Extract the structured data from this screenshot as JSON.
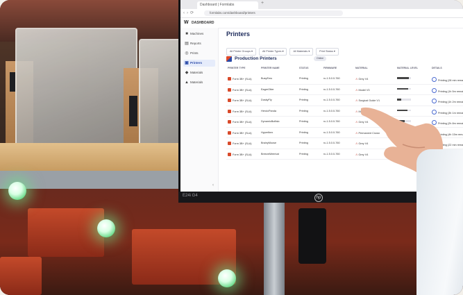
{
  "browser": {
    "tab_title": "Dashboard | Formlabs",
    "new_tab": "+",
    "url": "formlabs.com/dashboard/printers"
  },
  "app": {
    "brand": "DASHBOARD"
  },
  "sidebar": {
    "items": [
      {
        "label": "Machines",
        "icon": "machine-icon"
      },
      {
        "label": "Reports",
        "icon": "report-icon"
      },
      {
        "label": "Prints",
        "icon": "print-icon"
      },
      {
        "label": "Printers",
        "icon": "printer-icon"
      },
      {
        "label": "Materials",
        "icon": "material-icon"
      },
      {
        "label": "Materials",
        "icon": "flask-icon"
      }
    ],
    "active_index": 3
  },
  "main": {
    "title": "Printers",
    "filters": [
      "All Printer Groups",
      "All Printer Types",
      "All Materials",
      "Print Status"
    ],
    "section_title": "Production Printers",
    "section_badge": "Online"
  },
  "table": {
    "columns": [
      "PRINTER TYPE",
      "PRINTER NAME",
      "STATUS",
      "FIRMWARE",
      "MATERIAL",
      "MATERIAL LEVEL",
      "DETAILS"
    ],
    "rows": [
      {
        "type": "Form 3B+ (SLA)",
        "name": "BusyEmu",
        "status": "Printing",
        "firmware": "rc-1.5.0.0-760",
        "material": "Grey V4",
        "level": 0.85,
        "details": "Printing (28 min remain)"
      },
      {
        "type": "Form 3B+ (SLA)",
        "name": "EagerOtter",
        "status": "Printing",
        "firmware": "rc-1.5.0.0-760",
        "material": "Model V3",
        "level": 0.8,
        "details": "Printing (1h 5m remain)"
      },
      {
        "type": "Form 3B+ (SLA)",
        "name": "DuskyFly",
        "status": "Printing",
        "firmware": "rc-1.5.0.0-760",
        "material": "Surgical Guide V1",
        "level": 0.3,
        "details": "Printing (1h 2m remain)"
      },
      {
        "type": "Form 3B+ (SLA)",
        "name": "HeroicPanda",
        "status": "Printing",
        "firmware": "rc-1.5.0.0-760",
        "material": "Model V3",
        "level": 0.75,
        "details": "Printing (3h 1m remain)"
      },
      {
        "type": "Form 3B+ (SLA)",
        "name": "DynamicBuffalo",
        "status": "Printing",
        "firmware": "rc-1.5.0.0-760",
        "material": "Grey V4",
        "level": 0.55,
        "details": "Printing (2h 8m remain)"
      },
      {
        "type": "Form 3B+ (SLA)",
        "name": "HyperIbex",
        "status": "Printing",
        "firmware": "rc-1.5.0.0-760",
        "material": "Permanent Crown",
        "level": 0.4,
        "details": "Printing (4h 15m remain)"
      },
      {
        "type": "Form 3B+ (SLA)",
        "name": "BrainyMoose",
        "status": "Printing",
        "firmware": "rc-1.5.0.0-760",
        "material": "Grey V4",
        "level": 0.5,
        "details": "Printing (22 min remain)"
      },
      {
        "type": "Form 3B+ (SLA)",
        "name": "BreezeMeerkat",
        "status": "Printing",
        "firmware": "rc-1.5.0.0-760",
        "material": "Grey V4",
        "level": 0.45,
        "details": "Printing (1h 9m remain)"
      }
    ]
  },
  "monitor": {
    "model": "E24i G4",
    "logo": "hp"
  },
  "colors": {
    "accent": "#2a4aa8",
    "printer_icon": "#d94a2a",
    "led_green": "#6cdc8c"
  }
}
